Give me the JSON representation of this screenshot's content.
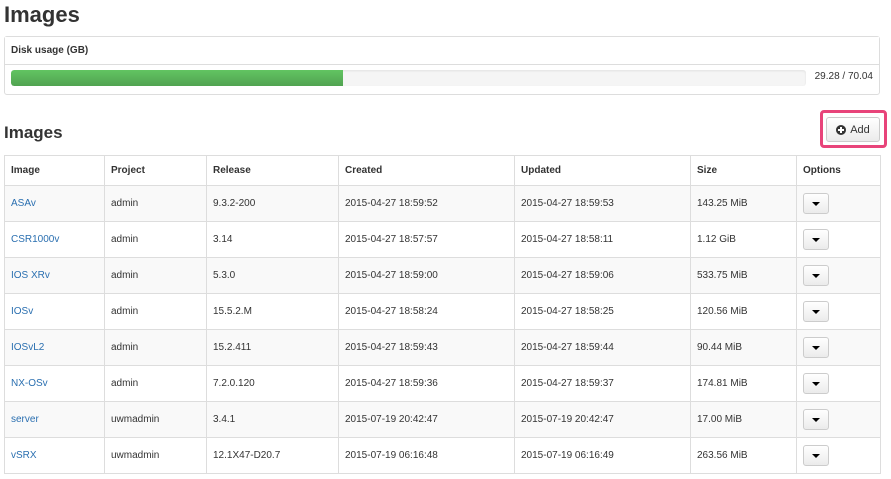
{
  "page": {
    "title": "Images"
  },
  "disk_usage": {
    "heading": "Disk usage (GB)",
    "used": 29.28,
    "total": 70.04,
    "text": "29.28 / 70.04",
    "fill_color": "#5cb85c"
  },
  "images_section": {
    "title": "Images",
    "add_label": "Add",
    "highlight_color": "#e8447a"
  },
  "table": {
    "headers": [
      "Image",
      "Project",
      "Release",
      "Created",
      "Updated",
      "Size",
      "Options"
    ],
    "rows": [
      {
        "image": "ASAv",
        "project": "admin",
        "release": "9.3.2-200",
        "created": "2015-04-27 18:59:52",
        "updated": "2015-04-27 18:59:53",
        "size": "143.25 MiB"
      },
      {
        "image": "CSR1000v",
        "project": "admin",
        "release": "3.14",
        "created": "2015-04-27 18:57:57",
        "updated": "2015-04-27 18:58:11",
        "size": "1.12 GiB"
      },
      {
        "image": "IOS XRv",
        "project": "admin",
        "release": "5.3.0",
        "created": "2015-04-27 18:59:00",
        "updated": "2015-04-27 18:59:06",
        "size": "533.75 MiB"
      },
      {
        "image": "IOSv",
        "project": "admin",
        "release": "15.5.2.M",
        "created": "2015-04-27 18:58:24",
        "updated": "2015-04-27 18:58:25",
        "size": "120.56 MiB"
      },
      {
        "image": "IOSvL2",
        "project": "admin",
        "release": "15.2.411",
        "created": "2015-04-27 18:59:43",
        "updated": "2015-04-27 18:59:44",
        "size": "90.44 MiB"
      },
      {
        "image": "NX-OSv",
        "project": "admin",
        "release": "7.2.0.120",
        "created": "2015-04-27 18:59:36",
        "updated": "2015-04-27 18:59:37",
        "size": "174.81 MiB"
      },
      {
        "image": "server",
        "project": "uwmadmin",
        "release": "3.4.1",
        "created": "2015-07-19 20:42:47",
        "updated": "2015-07-19 20:42:47",
        "size": "17.00 MiB"
      },
      {
        "image": "vSRX",
        "project": "uwmadmin",
        "release": "12.1X47-D20.7",
        "created": "2015-07-19 06:16:48",
        "updated": "2015-07-19 06:16:49",
        "size": "263.56 MiB"
      }
    ]
  }
}
